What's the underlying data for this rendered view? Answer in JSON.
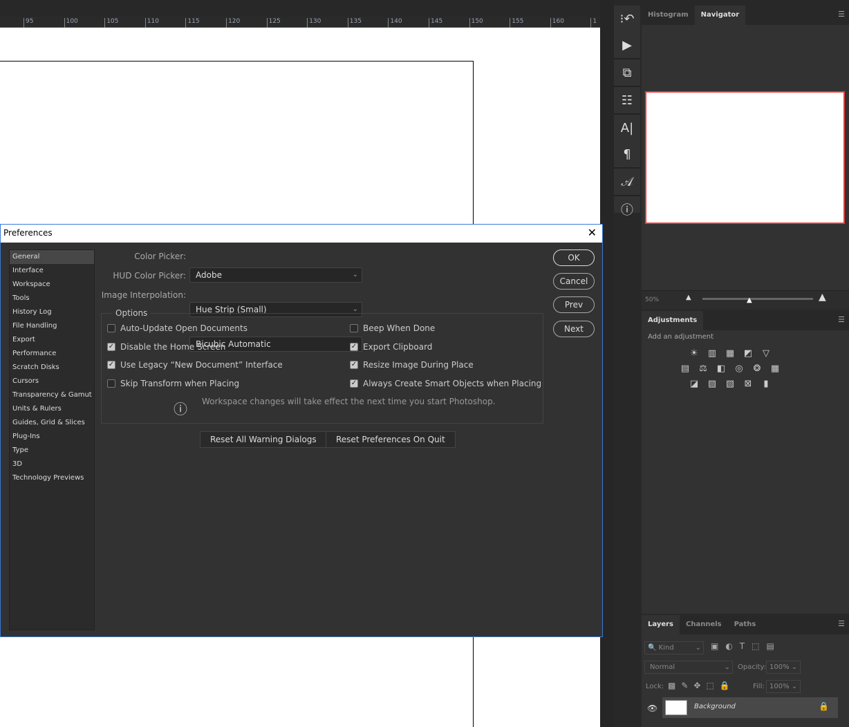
{
  "ruler": {
    "ticks": [
      "95",
      "100",
      "105",
      "110",
      "115",
      "120",
      "125",
      "130",
      "135",
      "140",
      "145",
      "150",
      "155",
      "160",
      "1"
    ]
  },
  "tools": [
    {
      "icon": "history-icon",
      "glyph": "⁝↶"
    },
    {
      "icon": "play-actions-icon",
      "glyph": "▶"
    },
    {
      "icon": "3d-icon",
      "glyph": "⧉"
    },
    {
      "icon": "clone-source-icon",
      "glyph": "☷"
    },
    {
      "icon": "character-icon",
      "glyph": "A|"
    },
    {
      "icon": "paragraph-icon",
      "glyph": "¶"
    },
    {
      "icon": "glyphs-icon",
      "glyph": "𝒜"
    },
    {
      "icon": "info-icon",
      "glyph": "ⓘ"
    }
  ],
  "navigator": {
    "tabs": [
      "Histogram",
      "Navigator"
    ],
    "active": "Navigator",
    "zoom": "50%",
    "frame_color": "#e84040"
  },
  "adjustments": {
    "tab": "Adjustments",
    "hint": "Add an adjustment",
    "rows": [
      [
        "☀",
        "▥",
        "▦",
        "◩",
        "▽"
      ],
      [
        "▤",
        "⚖",
        "◧",
        "◎",
        "❂",
        "▦"
      ],
      [
        "◪",
        "▨",
        "▧",
        "⊠",
        "▮"
      ]
    ]
  },
  "layers": {
    "tabs": [
      "Layers",
      "Channels",
      "Paths"
    ],
    "kind": "Kind",
    "blend": "Normal",
    "opacity_label": "Opacity:",
    "opacity": "100%",
    "lock_label": "Lock:",
    "fill_label": "Fill:",
    "fill": "100%",
    "layer_name": "Background"
  },
  "dialog": {
    "title": "Preferences",
    "sidebar": [
      "General",
      "Interface",
      "Workspace",
      "Tools",
      "History Log",
      "File Handling",
      "Export",
      "Performance",
      "Scratch Disks",
      "Cursors",
      "Transparency & Gamut",
      "Units & Rulers",
      "Guides, Grid & Slices",
      "Plug-Ins",
      "Type",
      "3D",
      "Technology Previews"
    ],
    "active": "General",
    "fields": [
      {
        "label": "Color Picker:",
        "value": "Adobe"
      },
      {
        "label": "HUD Color Picker:",
        "value": "Hue Strip (Small)"
      },
      {
        "label": "Image Interpolation:",
        "value": "Bicubic Automatic"
      }
    ],
    "options_title": "Options",
    "left_options": [
      {
        "label": "Auto-Update Open Documents",
        "checked": false
      },
      {
        "label": "Disable the Home Screen",
        "checked": true
      },
      {
        "label": "Use Legacy “New Document” Interface",
        "checked": true
      },
      {
        "label": "Skip Transform when Placing",
        "checked": false
      }
    ],
    "right_options": [
      {
        "label": "Beep When Done",
        "checked": false
      },
      {
        "label": "Export Clipboard",
        "checked": true
      },
      {
        "label": "Resize Image During Place",
        "checked": true
      },
      {
        "label": "Always Create Smart Objects when Placing",
        "checked": true
      }
    ],
    "notice": "Workspace changes will take effect the next time you start Photoshop.",
    "reset_warnings": "Reset All Warning Dialogs",
    "reset_prefs": "Reset Preferences On Quit",
    "buttons": {
      "ok": "OK",
      "cancel": "Cancel",
      "prev": "Prev",
      "next": "Next"
    }
  }
}
